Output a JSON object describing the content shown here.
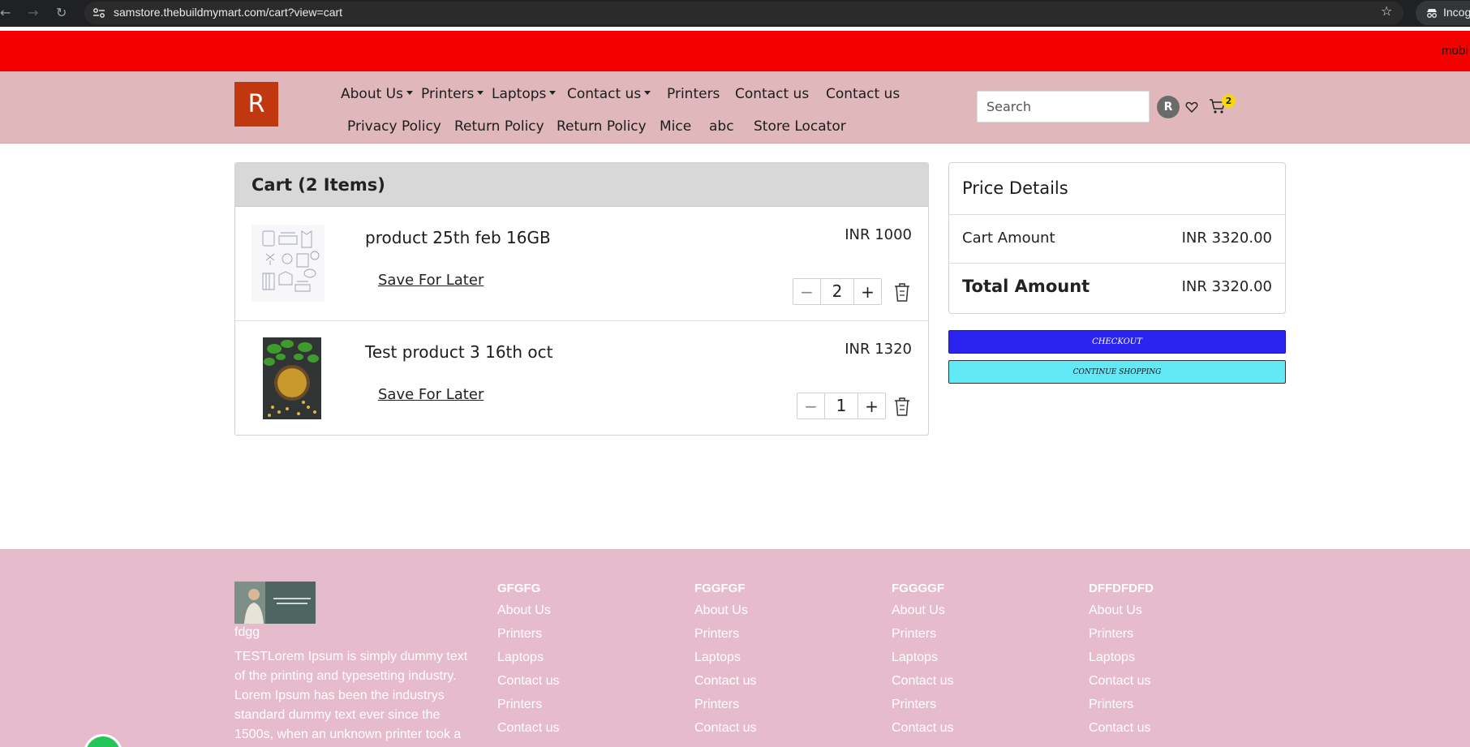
{
  "browser": {
    "url": "samstore.thebuildmymart.com/cart?view=cart",
    "incognito_label": "Incognito"
  },
  "announcement": {
    "text": "mobi"
  },
  "header": {
    "logo_letter": "R",
    "nav_row1": [
      {
        "label": "About Us",
        "dropdown": true
      },
      {
        "label": "Printers",
        "dropdown": true
      },
      {
        "label": "Laptops",
        "dropdown": true
      },
      {
        "label": "Contact us",
        "dropdown": true
      },
      {
        "label": "Printers",
        "dropdown": false
      },
      {
        "label": "Contact us",
        "dropdown": false
      },
      {
        "label": "Contact us",
        "dropdown": false
      }
    ],
    "nav_row2": [
      {
        "label": "Privacy Policy"
      },
      {
        "label": "Return Policy"
      },
      {
        "label": "Return Policy"
      },
      {
        "label": "Mice"
      },
      {
        "label": "abc"
      },
      {
        "label": "Store Locator"
      }
    ],
    "search_placeholder": "Search",
    "avatar_letter": "R",
    "cart_count": "2"
  },
  "cart": {
    "title": "Cart (2 Items)",
    "items": [
      {
        "name": "product 25th feb 16GB",
        "price": "INR 1000",
        "save_label": "Save For Later",
        "qty": "2",
        "image": "line-art-products-image"
      },
      {
        "name": "Test product 3 16th oct",
        "price": "INR 1320",
        "save_label": "Save For Later",
        "qty": "1",
        "image": "fenugreek-bowl-image"
      }
    ],
    "minus_label": "−",
    "plus_label": "+"
  },
  "price_details": {
    "title": "Price Details",
    "cart_amount_label": "Cart Amount",
    "cart_amount": "INR 3320.00",
    "total_label": "Total Amount",
    "total_amount": "INR 3320.00",
    "checkout_label": "CHECKOUT",
    "continue_label": "CONTINUE SHOPPING"
  },
  "footer": {
    "brand": "fdgg",
    "about": "TESTLorem Ipsum is simply dummy text of the printing and typesetting industry. Lorem Ipsum has been the industrys standard dummy text ever since the 1500s, when an unknown printer took a",
    "columns": [
      {
        "heading": "GFGFG",
        "links": [
          "About Us",
          "Printers",
          "Laptops",
          "Contact us",
          "Printers",
          "Contact us"
        ]
      },
      {
        "heading": "FGGFGF",
        "links": [
          "About Us",
          "Printers",
          "Laptops",
          "Contact us",
          "Printers",
          "Contact us"
        ]
      },
      {
        "heading": "FGGGGF",
        "links": [
          "About Us",
          "Printers",
          "Laptops",
          "Contact us",
          "Printers",
          "Contact us"
        ]
      },
      {
        "heading": "DFFDFDFD",
        "links": [
          "About Us",
          "Printers",
          "Laptops",
          "Contact us",
          "Printers",
          "Contact us"
        ]
      }
    ]
  },
  "colors": {
    "announcement_bg": "#f50000",
    "header_bg": "#e0b8bb",
    "logo_bg": "#c1370f",
    "checkout_bg": "#2b23ef",
    "continue_bg": "#62e9f8",
    "footer_bg": "#e6bccc",
    "badge_bg": "#f5d90a"
  }
}
